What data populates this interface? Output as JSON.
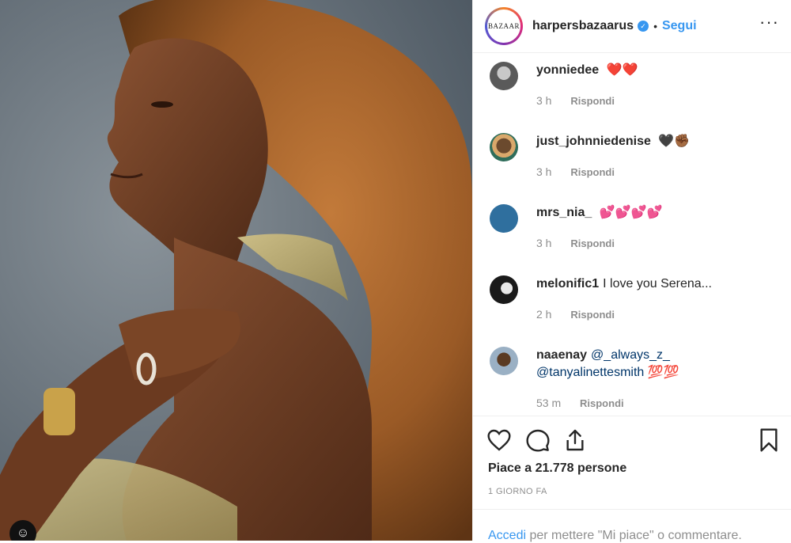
{
  "header": {
    "logo_text": "BAZAAR",
    "username": "harpersbazaarus",
    "verified_icon": "verified-badge-icon",
    "separator": "•",
    "follow_label": "Segui",
    "more_label": "···"
  },
  "comments": [
    {
      "user": "yonniedee",
      "text": "❤️❤️",
      "time": "3 h",
      "reply": "Rispondi"
    },
    {
      "user": "just_johnniedenise",
      "text": "🖤✊🏾",
      "time": "3 h",
      "reply": "Rispondi"
    },
    {
      "user": "mrs_nia_",
      "text": "💕💕💕💕",
      "time": "3 h",
      "reply": "Rispondi"
    },
    {
      "user": "melonific1",
      "text": "I love you Serena...",
      "time": "2 h",
      "reply": "Rispondi"
    },
    {
      "user": "naaenay",
      "mention1": "@_always_z_",
      "mention2": "@tanyalinettesmith",
      "text_after": "💯💯",
      "time": "53 m",
      "reply": "Rispondi"
    }
  ],
  "actions": {
    "like_icon": "heart-icon",
    "comment_icon": "comment-icon",
    "share_icon": "share-icon",
    "save_icon": "bookmark-icon",
    "likes_text": "Piace a 21.778 persone",
    "time_text": "1 GIORNO FA"
  },
  "footer": {
    "login_label": "Accedi",
    "rest_text": " per mettere \"Mi piace\" o commentare."
  },
  "colors": {
    "accent": "#3897f0",
    "text": "#262626",
    "muted": "#8e8e8e"
  }
}
